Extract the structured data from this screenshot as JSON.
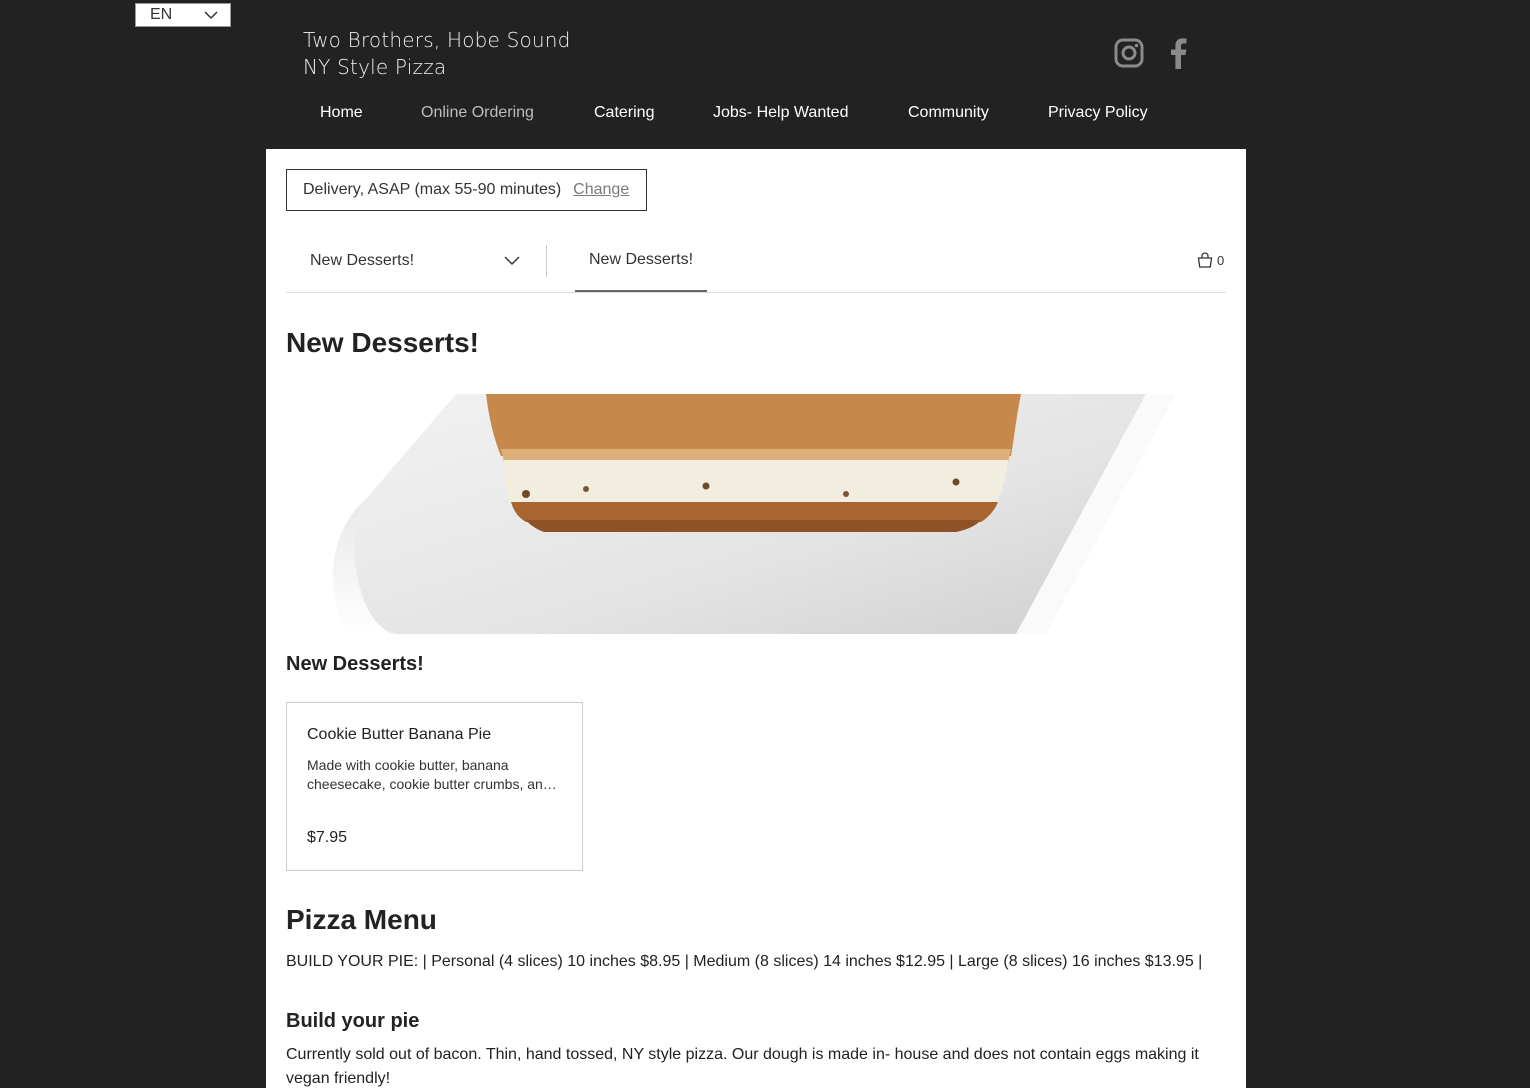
{
  "language": {
    "selected": "EN"
  },
  "site": {
    "title_line1": "Two Brothers, Hobe Sound",
    "title_line2": "NY Style Pizza"
  },
  "social": {
    "icons": [
      "instagram-icon",
      "facebook-icon"
    ],
    "icon_color": "#8a8a8a"
  },
  "nav": {
    "items": [
      {
        "label": "Home"
      },
      {
        "label": "Online Ordering"
      },
      {
        "label": "Catering"
      },
      {
        "label": "Jobs- Help Wanted"
      },
      {
        "label": "Community"
      },
      {
        "label": "Privacy Policy"
      }
    ],
    "active_index": 1
  },
  "order": {
    "delivery_text": "Delivery, ASAP (max 55-90 minutes)",
    "change_label": "Change"
  },
  "menu_bar": {
    "selected_menu": "New Desserts!",
    "tab_label": "New Desserts!",
    "cart_count": "0"
  },
  "section": {
    "title": "New Desserts!",
    "subsection_title": "New Desserts!"
  },
  "items": [
    {
      "name": "Cookie Butter Banana Pie",
      "description": "Made with cookie butter, banana cheesecake, cookie butter crumbs, and a graham cracker crust.",
      "price": "$7.95"
    }
  ],
  "pizza_menu": {
    "title": "Pizza Menu",
    "build_line": "BUILD YOUR PIE: | Personal (4 slices) 10 inches $8.95 | Medium (8 slices) 14 inches $12.95 | Large (8 slices) 16 inches $13.95 |",
    "build_title": "Build your pie",
    "build_description": "Currently sold out of bacon. Thin, hand tossed, NY style pizza. Our dough is made in- house and does not contain eggs making it vegan friendly!"
  },
  "colors": {
    "background": "#222222",
    "panel": "#ffffff",
    "accent_underline": "#666666"
  }
}
